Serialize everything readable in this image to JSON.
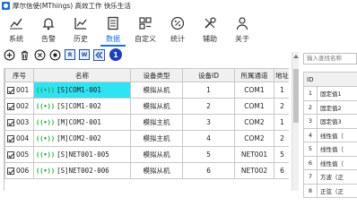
{
  "window": {
    "title": "摩尔信使(MThings) 高效工作 快乐生活"
  },
  "nav": {
    "items": [
      {
        "key": "system",
        "label": "系统",
        "icon": "gear-icon"
      },
      {
        "key": "alarm",
        "label": "告警",
        "icon": "bell-icon"
      },
      {
        "key": "history",
        "label": "历史",
        "icon": "chart-icon"
      },
      {
        "key": "data",
        "label": "数据",
        "icon": "document-icon",
        "active": true
      },
      {
        "key": "custom",
        "label": "自定义",
        "icon": "grid-icon"
      },
      {
        "key": "stats",
        "label": "统计",
        "icon": "percent-icon"
      },
      {
        "key": "assist",
        "label": "辅助",
        "icon": "tools-icon"
      },
      {
        "key": "about",
        "label": "关于",
        "icon": "person-icon"
      }
    ]
  },
  "toolbar": {
    "r_label": "R",
    "w_label": "W",
    "badge": "1"
  },
  "table": {
    "headers": [
      "序号",
      "名称",
      "设备类型",
      "设备ID",
      "所属通道",
      "地址"
    ],
    "rows": [
      {
        "seq": "001",
        "name": "[S]COM1-001",
        "type": "模拟从机",
        "id": "1",
        "channel": "COM1",
        "addr": "1",
        "selected": true
      },
      {
        "seq": "002",
        "name": "[S]COM1-002",
        "type": "模拟从机",
        "id": "2",
        "channel": "COM1",
        "addr": "2"
      },
      {
        "seq": "003",
        "name": "[M]COM2-001",
        "type": "模拟主机",
        "id": "3",
        "channel": "COM2",
        "addr": "1"
      },
      {
        "seq": "004",
        "name": "[M]COM2-002",
        "type": "模拟主机",
        "id": "4",
        "channel": "COM2",
        "addr": "2"
      },
      {
        "seq": "005",
        "name": "[S]NET001-005",
        "type": "模拟从机",
        "id": "5",
        "channel": "NET001",
        "addr": "5"
      },
      {
        "seq": "006",
        "name": "[S]NET002-006",
        "type": "模拟从机",
        "id": "6",
        "channel": "NET002",
        "addr": "6"
      }
    ]
  },
  "right_panel": {
    "search_placeholder": "输入查找名称",
    "header": "ID",
    "rows": [
      {
        "id": "1",
        "name": "固定值1"
      },
      {
        "id": "2",
        "name": "固定值2"
      },
      {
        "id": "3",
        "name": "固定值3"
      },
      {
        "id": "4",
        "name": "线性值（"
      },
      {
        "id": "5",
        "name": "线性值（"
      },
      {
        "id": "6",
        "name": "线性值（"
      },
      {
        "id": "7",
        "name": "方波（正"
      },
      {
        "id": "8",
        "name": "正弦（正"
      }
    ]
  }
}
